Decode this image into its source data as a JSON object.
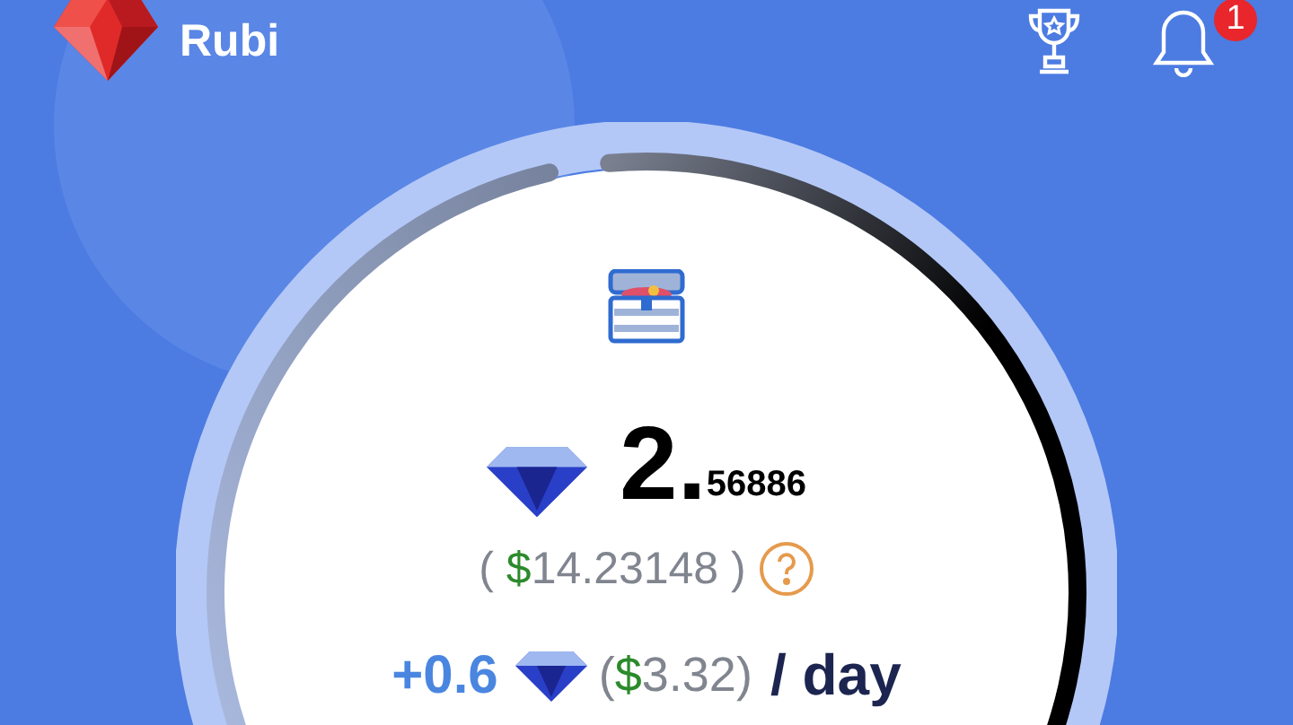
{
  "app": {
    "name": "Rubi"
  },
  "notifications": {
    "badge": "1"
  },
  "balance": {
    "whole": "2.",
    "fraction": "56886"
  },
  "usd_value": {
    "prefix": "( ",
    "currency": "$",
    "amount": "14.23148",
    "suffix": " )"
  },
  "rate": {
    "amount": "+0.6",
    "usd_prefix": "(",
    "currency": "$",
    "usd_amount": "3.32",
    "usd_suffix": ")",
    "period": "/ day"
  }
}
